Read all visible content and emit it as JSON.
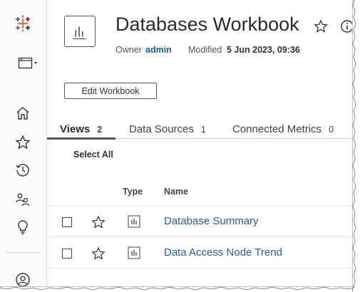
{
  "workbook": {
    "title": "Databases Workbook",
    "owner_label": "Owner",
    "owner_name": "admin",
    "modified_label": "Modified",
    "modified_value": "5 Jun 2023, 09:36"
  },
  "actions": {
    "edit_label": "Edit Workbook"
  },
  "tabs": [
    {
      "label": "Views",
      "count": "2"
    },
    {
      "label": "Data Sources",
      "count": "1"
    },
    {
      "label": "Connected Metrics",
      "count": "0"
    }
  ],
  "list": {
    "select_all": "Select All",
    "col_type": "Type",
    "col_name": "Name",
    "rows": [
      {
        "name": "Database Summary",
        "type_icon": "view-icon"
      },
      {
        "name": "Data Access Node Trend",
        "type_icon": "view-icon"
      }
    ]
  },
  "colors": {
    "link": "#1f5f9c",
    "rail_bg": "#fbfbfb",
    "text": "#2b2b2b"
  },
  "icons": {
    "rail": [
      "tableau-logo-icon",
      "browse-content-icon",
      "home-icon",
      "favorites-star-icon",
      "recents-clock-icon",
      "groups-icon",
      "recommendations-bulb-icon",
      "user-avatar-icon"
    ]
  }
}
